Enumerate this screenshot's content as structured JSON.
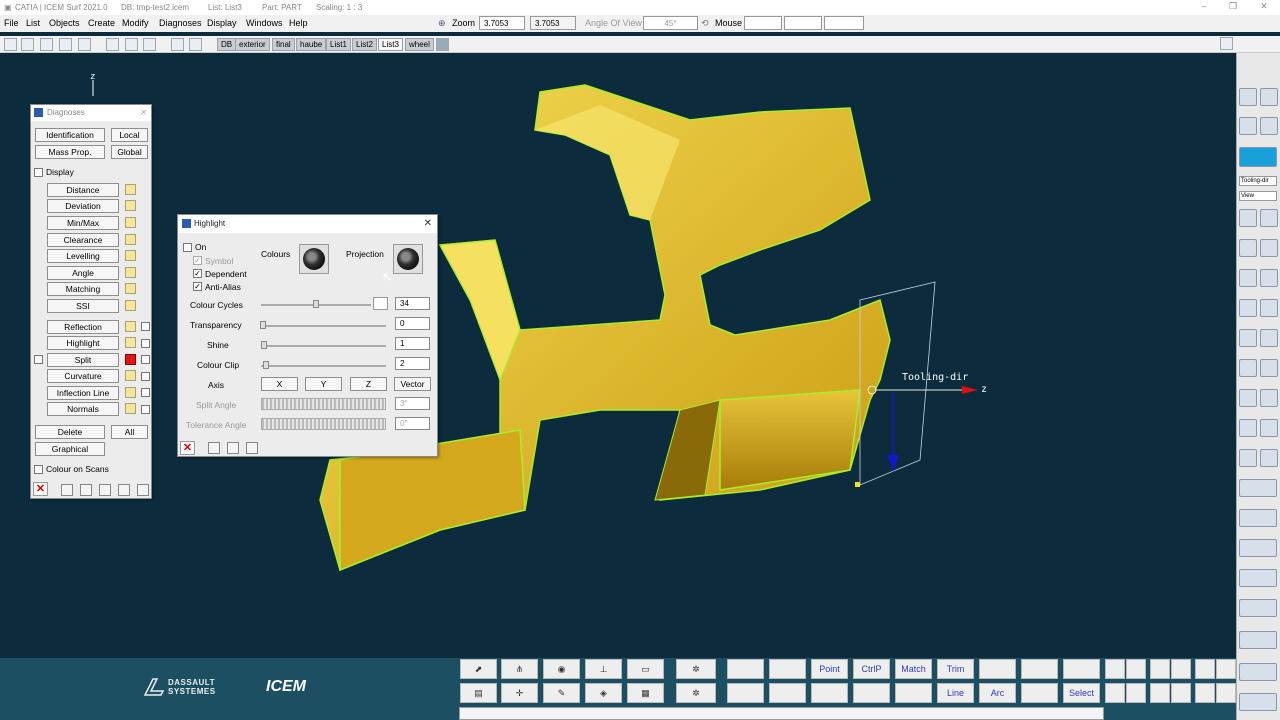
{
  "titlebar": {
    "app": "CATIA | ICEM Surf 2021.0",
    "db": "DB: tmp-test2.icem",
    "list": "List: List3",
    "part": "Part: PART",
    "scaling": "Scaling: 1 : 3"
  },
  "menu": [
    "File",
    "List",
    "Objects",
    "Create",
    "Modify",
    "Diagnoses",
    "Display",
    "Windows",
    "Help"
  ],
  "zoom": {
    "label": "Zoom",
    "value1": "3.7053",
    "value2": "3.7053"
  },
  "angle": {
    "label": "Angle Of View",
    "value": "45°"
  },
  "mouse": {
    "label": "Mouse"
  },
  "list_tabs": [
    "DB",
    "exterior",
    "final",
    "haube",
    "List1",
    "List2",
    "List3",
    "wheel"
  ],
  "viewport": {
    "axis_label": "z",
    "annotation": "Tooling-dir",
    "axis_z": "z"
  },
  "diagnoses": {
    "title": "Diagnoses",
    "identification": "Identification",
    "local": "Local",
    "mass_prop": "Mass Prop.",
    "global": "Global",
    "display": "Display",
    "items": [
      "Distance",
      "Deviation",
      "Min/Max",
      "Clearance",
      "Levelling",
      "Angle",
      "Matching",
      "SSI"
    ],
    "items2": [
      "Reflection",
      "Highlight",
      "Split",
      "Curvature",
      "Inflection Line",
      "Normals"
    ],
    "delete": "Delete",
    "all": "All",
    "graphical": "Graphical",
    "colour_on_scans": "Colour on Scans"
  },
  "highlight": {
    "title": "Highlight",
    "on": "On",
    "symbol": "Symbol",
    "dependent": "Dependent",
    "anti_alias": "Anti-Alias",
    "colours": "Colours",
    "projection": "Projection",
    "colour_cycles": "Colour Cycles",
    "colour_cycles_value": "34",
    "transparency": "Transparency",
    "transparency_value": "0",
    "shine": "Shine",
    "shine_value": "1",
    "colour_clip": "Colour Clip",
    "colour_clip_value": "2",
    "axis": "Axis",
    "x": "X",
    "y": "Y",
    "z": "Z",
    "vector": "Vector",
    "split_angle": "Split Angle",
    "split_angle_value": "3°",
    "tolerance_angle": "Tolerance Angle",
    "tolerance_angle_value": "0°"
  },
  "bottom": {
    "point": "Point",
    "ctrlp": "CtrlP",
    "match": "Match",
    "trim": "Trim",
    "line": "Line",
    "arc": "Arc",
    "select": "Select"
  },
  "branding": {
    "dassault_1": "DASSAULT",
    "dassault_2": "SYSTEMES",
    "icem": "ICEM"
  },
  "right_selects": [
    "Tooling-dir",
    "View"
  ],
  "colors": {
    "background": "#0c2c3e",
    "part": "#e8c42a",
    "edge": "#a6ef2a",
    "bottom_bar": "#1d4f62"
  }
}
